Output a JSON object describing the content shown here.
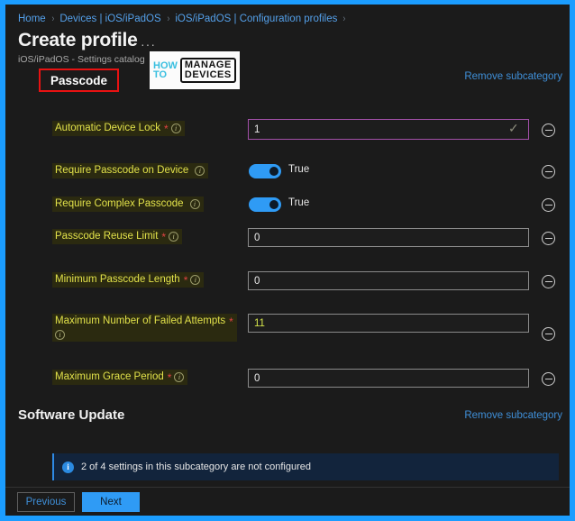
{
  "breadcrumb": {
    "items": [
      "Home",
      "Devices | iOS/iPadOS",
      "iOS/iPadOS | Configuration profiles"
    ],
    "separator": "›"
  },
  "header": {
    "title": "Create profile",
    "ellipsis": "···",
    "subtitle": "iOS/iPadOS - Settings catalog",
    "highlighted_chip": "Passcode",
    "highlight_box_color": "#e81212"
  },
  "watermark": {
    "line1": "HOW",
    "line2": "TO",
    "word1": "MANAGE",
    "word2": "DEVICES"
  },
  "links": {
    "remove_subcategory_passcode": "Remove subcategory",
    "remove_subcategory_software": "Remove subcategory"
  },
  "settings": [
    {
      "label": "Automatic Device Lock",
      "required": "*",
      "info": "i",
      "control": "text",
      "value": "1",
      "focused": true,
      "check": "✓",
      "remove": "minus-circle"
    },
    {
      "label": "Require Passcode on Device",
      "required": "",
      "info": "i",
      "control": "toggle",
      "value": "True",
      "remove": "minus-circle"
    },
    {
      "label": "Require Complex Passcode",
      "required": "",
      "info": "i",
      "control": "toggle",
      "value": "True",
      "remove": "minus-circle"
    },
    {
      "label": "Passcode Reuse Limit",
      "required": "*",
      "info": "i",
      "control": "text",
      "value": "0",
      "remove": "minus-circle"
    },
    {
      "label": "Minimum Passcode Length",
      "required": "*",
      "info": "i",
      "control": "text",
      "value": "0",
      "remove": "minus-circle"
    },
    {
      "label": "Maximum Number of Failed Attempts",
      "required": "*",
      "info": "i",
      "control": "text",
      "value": "11",
      "highlighted": true,
      "remove": "minus-circle"
    },
    {
      "label": "Maximum Grace Period",
      "required": "*",
      "info": "i",
      "control": "text",
      "value": "0",
      "remove": "minus-circle"
    }
  ],
  "software_update": {
    "title": "Software Update"
  },
  "info_banner": {
    "icon": "i",
    "text": "2 of 4 settings in this subcategory are not configured",
    "accent": "#2e8ae5"
  },
  "footer": {
    "previous": "Previous",
    "next": "Next"
  },
  "theme": {
    "background": "#1b1b1b",
    "frame": "#1b9dff",
    "accent_blue": "#2f9bf5",
    "label_yellow": "#e2e24a",
    "focus_purple": "#a250a8"
  }
}
